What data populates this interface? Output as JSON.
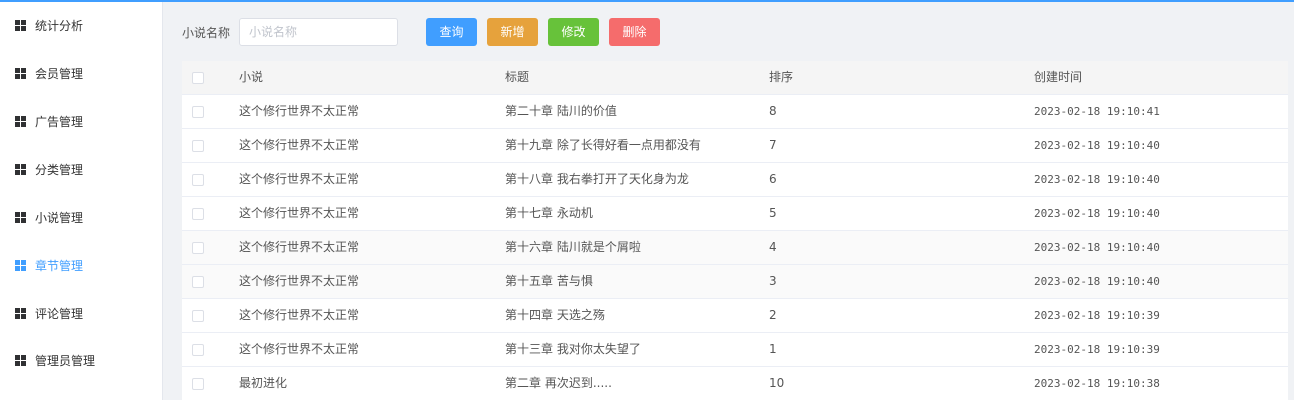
{
  "sidebar": {
    "items": [
      {
        "label": "统计分析",
        "icon": "grid-icon",
        "active": false
      },
      {
        "label": "会员管理",
        "icon": "grid-icon",
        "active": false
      },
      {
        "label": "广告管理",
        "icon": "grid-icon",
        "active": false
      },
      {
        "label": "分类管理",
        "icon": "grid-icon",
        "active": false
      },
      {
        "label": "小说管理",
        "icon": "grid-icon",
        "active": false
      },
      {
        "label": "章节管理",
        "icon": "grid-icon",
        "active": true
      },
      {
        "label": "评论管理",
        "icon": "grid-icon",
        "active": false
      },
      {
        "label": "管理员管理",
        "icon": "grid-icon",
        "active": false
      }
    ]
  },
  "search": {
    "label": "小说名称",
    "placeholder": "小说名称",
    "value": ""
  },
  "toolbar": {
    "query_label": "查询",
    "add_label": "新增",
    "edit_label": "修改",
    "delete_label": "删除"
  },
  "colors": {
    "accent": "#409eff",
    "add": "#e6a23c",
    "edit": "#67c23a",
    "delete": "#f56c6c"
  },
  "table": {
    "headers": [
      "小说",
      "标题",
      "排序",
      "创建时间"
    ],
    "rows": [
      {
        "novel": "这个修行世界不太正常",
        "title": "第二十章 陆川的价值",
        "sort": "8",
        "time": "2023-02-18 19:10:41"
      },
      {
        "novel": "这个修行世界不太正常",
        "title": "第十九章 除了长得好看一点用都没有",
        "sort": "7",
        "time": "2023-02-18 19:10:40"
      },
      {
        "novel": "这个修行世界不太正常",
        "title": "第十八章 我右拳打开了天化身为龙",
        "sort": "6",
        "time": "2023-02-18 19:10:40"
      },
      {
        "novel": "这个修行世界不太正常",
        "title": "第十七章 永动机",
        "sort": "5",
        "time": "2023-02-18 19:10:40"
      },
      {
        "novel": "这个修行世界不太正常",
        "title": "第十六章 陆川就是个屑啦",
        "sort": "4",
        "time": "2023-02-18 19:10:40"
      },
      {
        "novel": "这个修行世界不太正常",
        "title": "第十五章 苦与惧",
        "sort": "3",
        "time": "2023-02-18 19:10:40"
      },
      {
        "novel": "这个修行世界不太正常",
        "title": "第十四章 天选之殇",
        "sort": "2",
        "time": "2023-02-18 19:10:39"
      },
      {
        "novel": "这个修行世界不太正常",
        "title": "第十三章 我对你太失望了",
        "sort": "1",
        "time": "2023-02-18 19:10:39"
      },
      {
        "novel": "最初进化",
        "title": "第二章 再次迟到.....",
        "sort": "10",
        "time": "2023-02-18 19:10:38"
      }
    ]
  }
}
